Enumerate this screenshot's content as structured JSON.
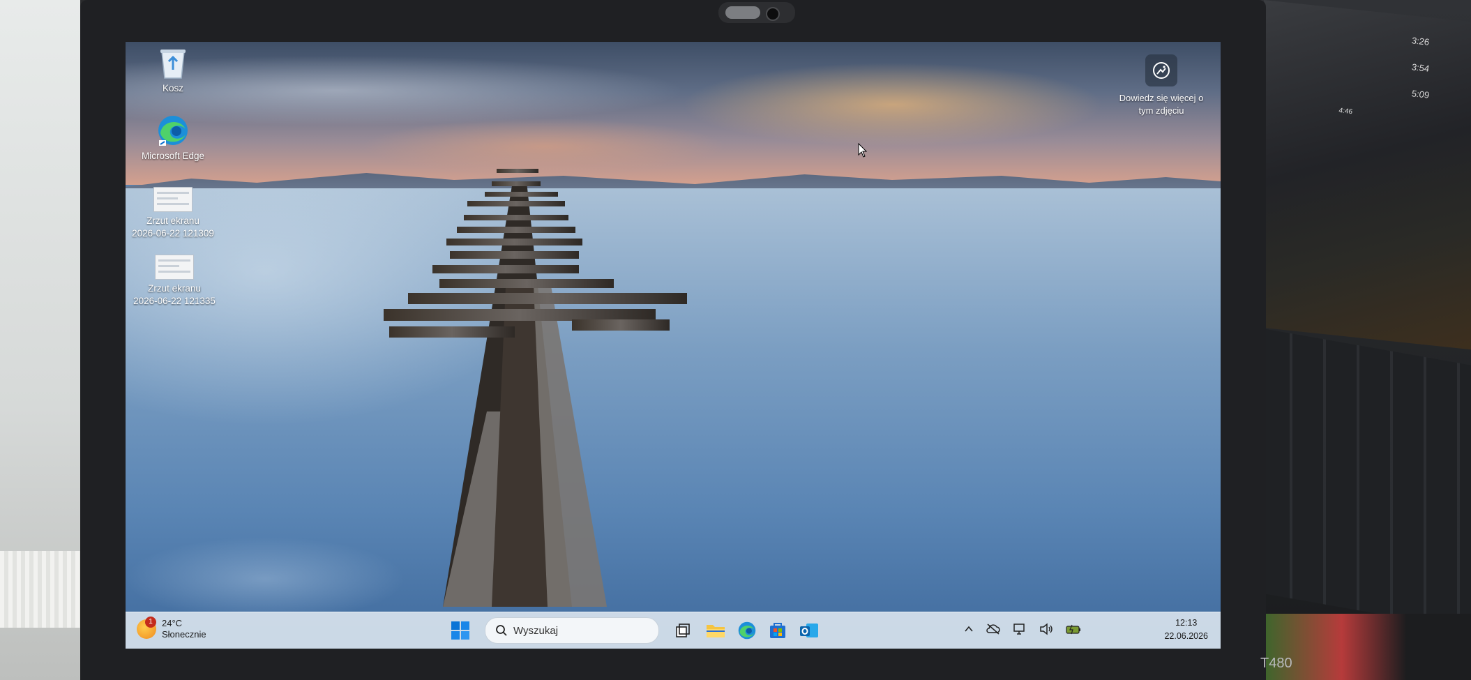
{
  "desktop": {
    "icons": [
      {
        "label": "Kosz"
      },
      {
        "label": "Microsoft Edge"
      },
      {
        "label": "Zrzut ekranu",
        "sublabel": "2026-06-22 121309"
      },
      {
        "label": "Zrzut ekranu",
        "sublabel": "2026-06-22 121335"
      }
    ],
    "spotlight": {
      "label": "Dowiedz się więcej o tym zdjęciu"
    }
  },
  "taskbar": {
    "weather": {
      "temperature": "24°C",
      "condition": "Słonecznie",
      "badge": "1"
    },
    "search_placeholder": "Wyszukaj",
    "pinned_icons": [
      "start-icon",
      "task-view-icon",
      "file-explorer-icon",
      "edge-icon",
      "microsoft-store-icon",
      "outlook-icon"
    ],
    "tray_icons": [
      "chevron-up-icon",
      "cloud-off-icon",
      "network-icon",
      "volume-icon",
      "battery-icon"
    ],
    "clock": {
      "time": "12:13",
      "date": "22.06.2026"
    }
  },
  "device": {
    "model": "T480"
  },
  "second_screen": {
    "times": [
      "3:26",
      "3:54",
      "5:09",
      "4:46"
    ]
  },
  "colors": {
    "accent": "#0067c0",
    "taskbar_bg": "#d6e1ec",
    "badge": "#c42b1c"
  }
}
